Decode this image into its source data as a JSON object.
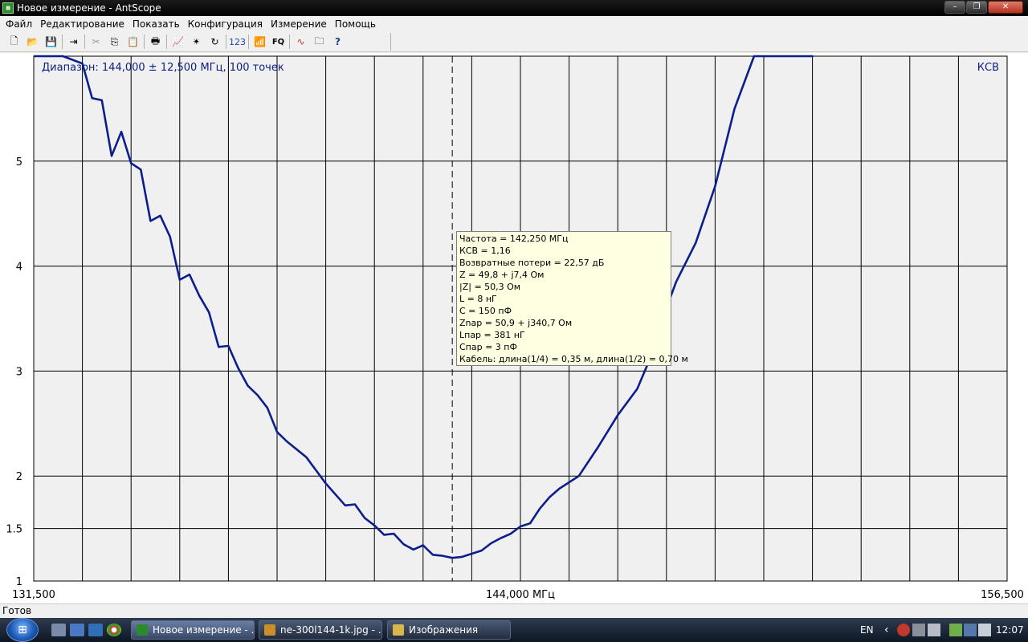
{
  "window": {
    "title": "Новое измерение - AntScope",
    "minimize_glyph": "–",
    "maximize_glyph": "❐",
    "close_glyph": "✕"
  },
  "menu": [
    "Файл",
    "Редактирование",
    "Показать",
    "Конфигурация",
    "Измерение",
    "Помощь"
  ],
  "toolbar": {
    "new_glyph": "🗋",
    "open_glyph": "📂",
    "save_glyph": "💾",
    "export_glyph": "⇥",
    "cut_glyph": "✂",
    "copy_glyph": "⎘",
    "paste_glyph": "📋",
    "print_glyph": "🖶",
    "chart_glyph": "📈",
    "marker_glyph": "✴",
    "refresh_glyph": "↻",
    "numeric_label": "123",
    "antenna_glyph": "📶",
    "fq_label": "FQ",
    "wave_glyph": "∿",
    "folder_glyph": "🗀",
    "help_glyph": "?"
  },
  "chart_data": {
    "type": "line",
    "header_left": "Диапазон: 144,000 ± 12,500 МГц, 100 точек",
    "header_right": "КСВ",
    "x_labels": [
      "131,500",
      "144,000 МГц",
      "156,500"
    ],
    "xlim": [
      131.5,
      156.5
    ],
    "y_tick_labels": [
      "1",
      "1.5",
      "2",
      "3",
      "4",
      "5"
    ],
    "y_tick_values": [
      1,
      1.5,
      2,
      3,
      4,
      5
    ],
    "ylim": [
      1,
      6
    ],
    "grid": true,
    "marker_x": 142.25,
    "series": [
      {
        "color": "#0c1e8c",
        "x": [
          131.5,
          132.25,
          132.75,
          133.0,
          133.25,
          133.5,
          133.75,
          134.0,
          134.25,
          134.5,
          134.75,
          135.0,
          135.25,
          135.5,
          135.75,
          136.0,
          136.25,
          136.5,
          136.75,
          137.0,
          137.25,
          137.5,
          137.75,
          138.0,
          138.5,
          139.0,
          139.5,
          139.75,
          140.0,
          140.25,
          140.5,
          140.75,
          141.0,
          141.25,
          141.5,
          141.75,
          142.0,
          142.25,
          142.5,
          142.75,
          143.0,
          143.25,
          143.5,
          143.75,
          144.0,
          144.25,
          144.5,
          144.75,
          145.0,
          145.5,
          146.0,
          146.5,
          147.0,
          147.25,
          147.5,
          147.75,
          148.0,
          148.5,
          149.0,
          149.5,
          150.0,
          150.5,
          151.0,
          151.5,
          150.75,
          151.2
        ],
        "y": [
          6.0,
          6.0,
          5.93,
          5.6,
          5.58,
          5.05,
          5.28,
          4.98,
          4.92,
          4.43,
          4.48,
          4.28,
          3.87,
          3.92,
          3.72,
          3.56,
          3.23,
          3.24,
          3.03,
          2.86,
          2.77,
          2.65,
          2.42,
          2.33,
          2.18,
          1.93,
          1.72,
          1.73,
          1.6,
          1.53,
          1.44,
          1.45,
          1.35,
          1.3,
          1.34,
          1.25,
          1.24,
          1.22,
          1.23,
          1.26,
          1.29,
          1.36,
          1.41,
          1.45,
          1.52,
          1.55,
          1.69,
          1.8,
          1.88,
          2.0,
          2.28,
          2.58,
          2.83,
          3.05,
          3.28,
          3.6,
          3.85,
          4.22,
          4.76,
          5.5,
          6.0,
          6.0,
          6.0,
          6.0,
          6.0,
          6.0
        ]
      }
    ]
  },
  "tooltip": [
    "Частота = 142,250 МГц",
    "КСВ = 1,16",
    "Возвратные потери = 22,57 дБ",
    "Z = 49,8 + j7,4 Ом",
    "|Z| = 50,3 Ом",
    "L = 8 нГ",
    "C = 150 пФ",
    "Znар = 50,9 + j340,7 Ом",
    "Lпар = 381 нГ",
    "Cпар = 3 пФ",
    "Кабель: длина(1/4) = 0,35 м, длина(1/2) = 0,70 м"
  ],
  "status": "Готов",
  "taskbar": {
    "tasks": [
      {
        "label": "Новое измерение - ...",
        "icon_color": "#2b8a2b"
      },
      {
        "label": "ne-300l144-1k.jpg - ...",
        "icon_color": "#c98f2b"
      },
      {
        "label": "Изображения",
        "icon_color": "#d9b64a"
      }
    ],
    "language": "EN",
    "tray_arrow": "‹",
    "clock": "12:07",
    "start_glyph": "⊞"
  }
}
